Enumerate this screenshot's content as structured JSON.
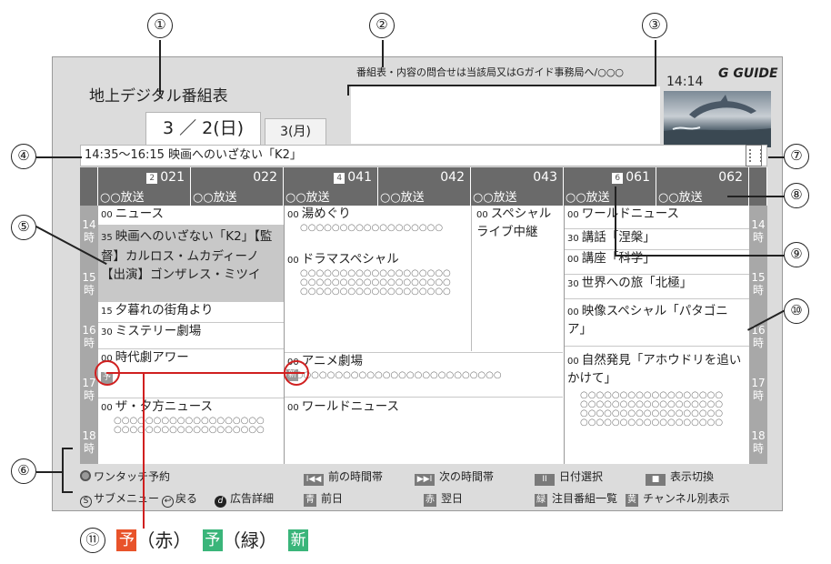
{
  "callouts": [
    "①",
    "②",
    "③",
    "④",
    "⑤",
    "⑥",
    "⑦",
    "⑧",
    "⑨",
    "⑩",
    "⑪"
  ],
  "header": {
    "title": "地上デジタル番組表",
    "notice": "番組表・内容の問合せは当該局又はGガイド事務局へ/○○○",
    "clock": "14:14",
    "logo": "G GUIDE"
  },
  "tabs": {
    "active": "3 ／ 2(日)",
    "next": "3(月)"
  },
  "infobar": {
    "text": "14:35～16:15  映画へのいざない「K2」"
  },
  "channels": [
    {
      "badge": "2",
      "num": "021",
      "name": "○○放送"
    },
    {
      "badge": "",
      "num": "022",
      "name": "○○放送"
    },
    {
      "badge": "4",
      "num": "041",
      "name": "○○放送"
    },
    {
      "badge": "",
      "num": "042",
      "name": "○○放送"
    },
    {
      "badge": "",
      "num": "043",
      "name": "○○放送"
    },
    {
      "badge": "6",
      "num": "061",
      "name": "○○放送"
    },
    {
      "badge": "",
      "num": "062",
      "name": "○○放送"
    }
  ],
  "hours": [
    "14\n時",
    "15\n時",
    "16\n時",
    "17\n時",
    "18\n時"
  ],
  "programs": {
    "g1": [
      {
        "min": "00",
        "title": "ニュース"
      },
      {
        "min": "35",
        "title": "映画へのいざない「K2」【監督】カルロス・ムカディーノ【出演】ゴンザレス・ミツイ"
      },
      {
        "min": "15",
        "title": "夕暮れの街角より"
      },
      {
        "min": "30",
        "title": "ミステリー劇場"
      },
      {
        "min": "00",
        "title": "時代劇アワー",
        "icon": "予"
      },
      {
        "min": "00",
        "title": "ザ・夕方ニュース",
        "desc": "○○○○○○○○○○○○○○○○○○○\n○○○○○○○○○○○○○○○○○○○"
      }
    ],
    "g2": [
      {
        "min": "00",
        "title": "湯めぐり",
        "desc": "○○○○○○○○○○○○○○○○○○"
      },
      {
        "min": "00",
        "title": "ドラマスペシャル",
        "desc": "○○○○○○○○○○○○○○○○○○○\n○○○○○○○○○○○○○○○○○○○\n○○○○○○○○○○○○○○○○○○○"
      },
      {
        "min": "00",
        "title": "アニメ劇場",
        "desc": "○○○○○○○○○○○○○○○○○○○○○○○○○○○",
        "icon": "新"
      },
      {
        "min": "00",
        "title": "ワールドニュース"
      }
    ],
    "g2b": [
      {
        "min": "00",
        "title": "スペシャル ライブ中継"
      }
    ],
    "g3": [
      {
        "min": "00",
        "title": "ワールドニュース"
      },
      {
        "min": "30",
        "title": "講話「涅槃」"
      },
      {
        "min": "00",
        "title": "講座「科学」"
      },
      {
        "min": "30",
        "title": "世界への旅「北極」"
      },
      {
        "min": "00",
        "title": "映像スペシャル「パタゴニア」"
      },
      {
        "min": "00",
        "title": "自然発見「アホウドリを追いかけて」",
        "desc": "○○○○○○○○○○○○○○○○○○\n○○○○○○○○○○○○○○○○○○\n○○○○○○○○○○○○○○○○○○\n○○○○○○○○○○○○○○○○○○"
      }
    ]
  },
  "footer": {
    "one_touch": "ワンタッチ予約",
    "prev_time": "前の時間帯",
    "next_time": "次の時間帯",
    "date_select": "日付選択",
    "display_switch": "表示切換",
    "submenu": "サブメニュー",
    "back": "戻る",
    "ad_detail": "広告詳細",
    "blue_key": "青",
    "blue_label": "前日",
    "red_key": "赤",
    "red_label": "翌日",
    "green_key": "緑",
    "green_label": "注目番組一覧",
    "yellow_key": "黄",
    "yellow_label": "チャンネル別表示"
  },
  "legend": {
    "icon1": "予",
    "label1": "（赤）",
    "icon2": "予",
    "label2": "（緑）",
    "icon3": "新",
    "color_red": "#e8532a",
    "color_green": "#3ab57a"
  }
}
